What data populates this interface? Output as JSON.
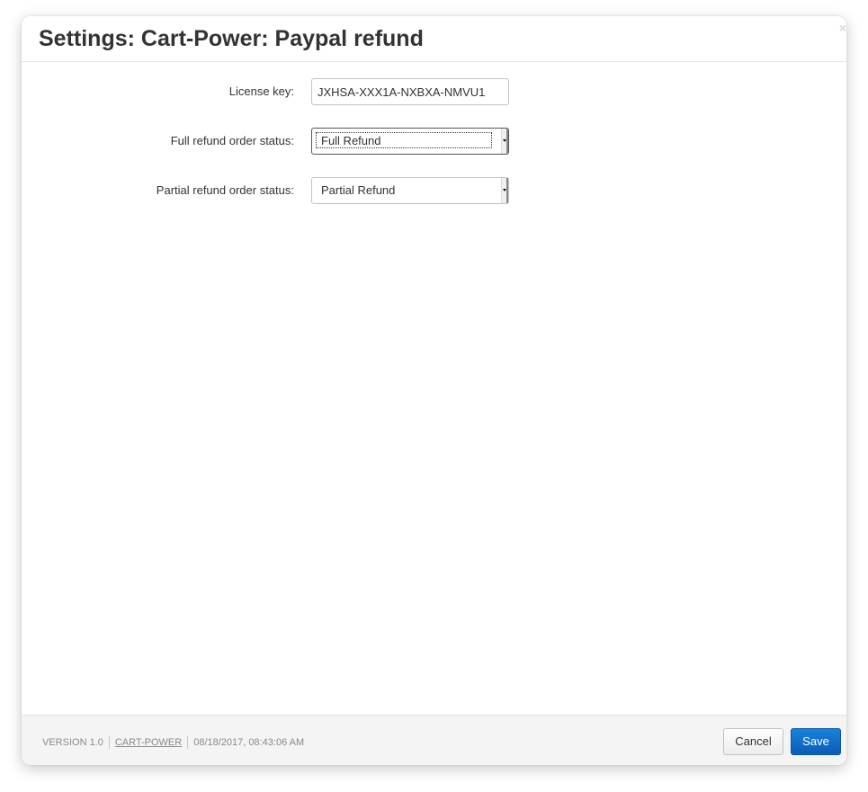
{
  "dialog": {
    "title": "Settings: Cart-Power: Paypal refund",
    "close_glyph": "×"
  },
  "form": {
    "license_key": {
      "label": "License key:",
      "value": "JXHSA-XXX1A-NXBXA-NMVU1"
    },
    "full_refund_status": {
      "label": "Full refund order status:",
      "selected": "Full Refund"
    },
    "partial_refund_status": {
      "label": "Partial refund order status:",
      "selected": "Partial Refund"
    }
  },
  "footer": {
    "version": "VERSION 1.0",
    "vendor_link": "CART-POWER",
    "timestamp": "08/18/2017, 08:43:06 AM",
    "cancel_label": "Cancel",
    "save_label": "Save"
  },
  "colors": {
    "save_button": "#0a6fd0",
    "title_text": "#333333"
  },
  "icons": {
    "close": "close-icon",
    "dropdown": "chevron-down-icon"
  }
}
